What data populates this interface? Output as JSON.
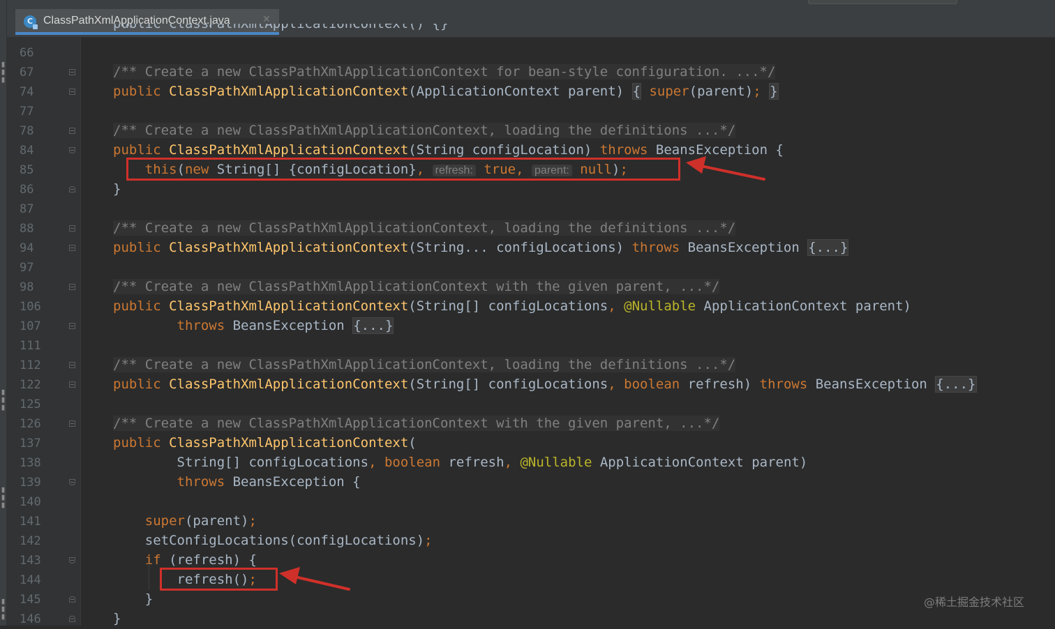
{
  "tab": {
    "icon_letter": "C",
    "title": "ClassPathXmlApplicationContext.java",
    "close_glyph": "✕"
  },
  "editor": {
    "top_partial_line": "public ClassPathXmlApplicationContext() {}",
    "line_numbers": [
      "66",
      "67",
      "74",
      "77",
      "78",
      "84",
      "85",
      "86",
      "87",
      "88",
      "94",
      "97",
      "98",
      "106",
      "107",
      "111",
      "112",
      "122",
      "125",
      "126",
      "137",
      "138",
      "139",
      "140",
      "141",
      "142",
      "143",
      "144",
      "145",
      "146"
    ],
    "lines": {
      "l67": {
        "comment": "/** Create a new ClassPathXmlApplicationContext for bean-style configuration. ...*/"
      },
      "l74": {
        "kw_public": "public",
        "ctor": "ClassPathXmlApplicationContext",
        "params": "(ApplicationContext parent) ",
        "brace_open": "{",
        "kw_super": "super",
        "args": "(parent)",
        "semi": ";",
        "brace_close": "}"
      },
      "l78": {
        "comment": "/** Create a new ClassPathXmlApplicationContext, loading the definitions ...*/"
      },
      "l84": {
        "kw_public": "public",
        "ctor": "ClassPathXmlApplicationContext",
        "params": "(String configLocation) ",
        "kw_throws": "throws",
        "tail": " BeansException {"
      },
      "l85": {
        "kw_this": "this",
        "open": "(",
        "kw_new": "new",
        "mid": " String[] {configLocation}",
        "comma1": ",",
        "hint1": "refresh:",
        "kw_true": "true",
        "comma2": ",",
        "hint2": "parent:",
        "kw_null": "null",
        "close": ")",
        "semi": ";"
      },
      "l86": {
        "text": "}"
      },
      "l88": {
        "comment": "/** Create a new ClassPathXmlApplicationContext, loading the definitions ...*/"
      },
      "l94": {
        "kw_public": "public",
        "ctor": "ClassPathXmlApplicationContext",
        "params": "(String... configLocations) ",
        "kw_throws": "throws",
        "tail": " BeansException ",
        "fold": "{...}"
      },
      "l98": {
        "comment": "/** Create a new ClassPathXmlApplicationContext with the given parent, ...*/"
      },
      "l106": {
        "kw_public": "public",
        "ctor": "ClassPathXmlApplicationContext",
        "params": "(String[] configLocations",
        "comma": ",",
        "annotation": "@Nullable",
        "tail": " ApplicationContext parent)"
      },
      "l107": {
        "kw_throws": "throws",
        "tail": " BeansException ",
        "fold": "{...}"
      },
      "l112": {
        "comment": "/** Create a new ClassPathXmlApplicationContext, loading the definitions ...*/"
      },
      "l122": {
        "kw_public": "public",
        "ctor": "ClassPathXmlApplicationContext",
        "params": "(String[] configLocations",
        "comma": ",",
        "kw_boolean": "boolean",
        "mid": " refresh) ",
        "kw_throws": "throws",
        "tail": " BeansException ",
        "fold": "{...}"
      },
      "l126": {
        "comment": "/** Create a new ClassPathXmlApplicationContext with the given parent, ...*/"
      },
      "l137": {
        "kw_public": "public",
        "ctor": "ClassPathXmlApplicationContext",
        "paren": "("
      },
      "l138": {
        "p1": "String[] configLocations",
        "comma1": ",",
        "kw_boolean": "boolean",
        "p2": " refresh",
        "comma2": ",",
        "annotation": "@Nullable",
        "p3": " ApplicationContext parent)"
      },
      "l139": {
        "kw_throws": "throws",
        "tail": " BeansException {"
      },
      "l141": {
        "kw_super": "super",
        "args": "(parent)",
        "semi": ";"
      },
      "l142": {
        "call": "setConfigLocations(configLocations)",
        "semi": ";"
      },
      "l143": {
        "kw_if": "if",
        "tail": " (refresh) {"
      },
      "l144": {
        "call": "refresh()",
        "semi": ";"
      },
      "l145": {
        "text": "}"
      },
      "l146": {
        "text": "}"
      }
    }
  },
  "watermark": "@稀土掘金技术社区",
  "colors": {
    "background": "#2b2b2b",
    "keyword": "#cc7832",
    "method": "#ffc66d",
    "comment": "#808080",
    "annotation": "#bbb529",
    "text": "#a9b7c6",
    "highlight": "#d0302a"
  }
}
